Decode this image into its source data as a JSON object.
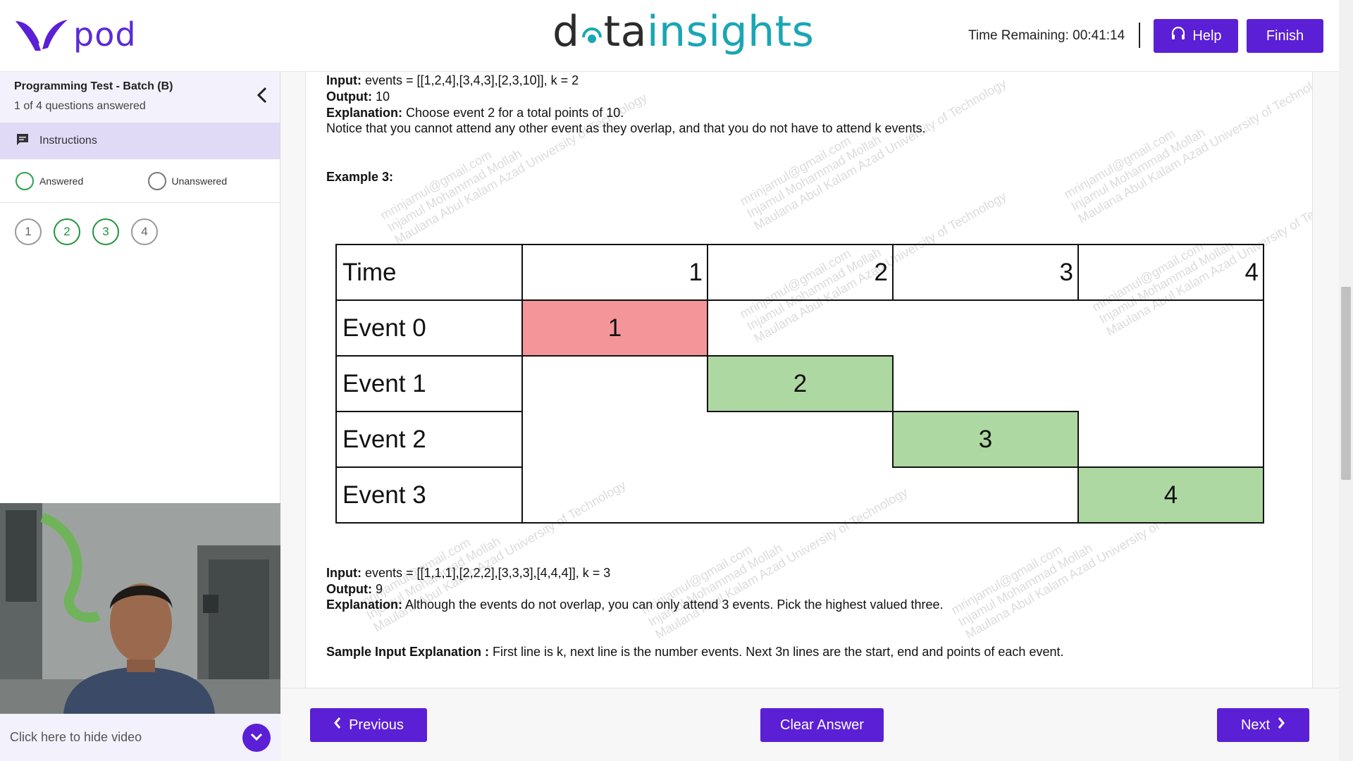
{
  "header": {
    "brand_name": "pod",
    "logo_part1": "d",
    "logo_part2": "ta",
    "logo_part3": "insights",
    "timer": "Time Remaining: 00:41:14",
    "help_label": "Help",
    "finish_label": "Finish"
  },
  "sidebar": {
    "test_title": "Programming Test - Batch (B)",
    "progress": "1 of 4 questions answered",
    "instructions_label": "Instructions",
    "legend": {
      "answered": "Answered",
      "unanswered": "Unanswered"
    },
    "questions": [
      {
        "num": "1",
        "answered": false
      },
      {
        "num": "2",
        "answered": true
      },
      {
        "num": "3",
        "answered": true
      },
      {
        "num": "4",
        "answered": false
      }
    ],
    "video_toggle_label": "Click here to hide video"
  },
  "content": {
    "ex2_input_label": "Input:",
    "ex2_input_value": "events = [[1,2,4],[3,4,3],[2,3,10]], k = 2",
    "ex2_output_label": "Output:",
    "ex2_output_value": "10",
    "ex2_expl_label": "Explanation:",
    "ex2_expl_value": "Choose event 2 for a total points of 10.",
    "ex2_notice": "Notice that you cannot attend any other event as they overlap, and that you do not have to attend k events.",
    "ex3_heading": "Example 3:",
    "table": {
      "time_label": "Time",
      "times": [
        "1",
        "2",
        "3",
        "4"
      ],
      "events": [
        "Event 0",
        "Event 1",
        "Event 2",
        "Event 3"
      ],
      "values": [
        "1",
        "2",
        "3",
        "4"
      ]
    },
    "ex3_input_label": "Input:",
    "ex3_input_value": "events = [[1,1,1],[2,2,2],[3,3,3],[4,4,4]], k = 3",
    "ex3_output_label": "Output:",
    "ex3_output_value": "9",
    "ex3_expl_label": "Explanation:",
    "ex3_expl_value": "Although the events do not overlap, you can only attend 3 events. Pick the highest valued three.",
    "sample_label": "Sample Input Explanation :",
    "sample_value": "First line is k, next line is the number events. Next 3n lines are the start, end and points of each event.",
    "watermark_email": "mrinjamul@gmail.com",
    "watermark_name": "Injamul Mohammad Mollah",
    "watermark_uni": "Maulana Abul Kalam Azad University of Technology"
  },
  "footer": {
    "previous_label": "Previous",
    "clear_label": "Clear Answer",
    "next_label": "Next"
  },
  "colors": {
    "accent": "#5b1fd6",
    "answered": "#22943f",
    "event_red": "#f4959a",
    "event_green": "#aed8a2"
  }
}
